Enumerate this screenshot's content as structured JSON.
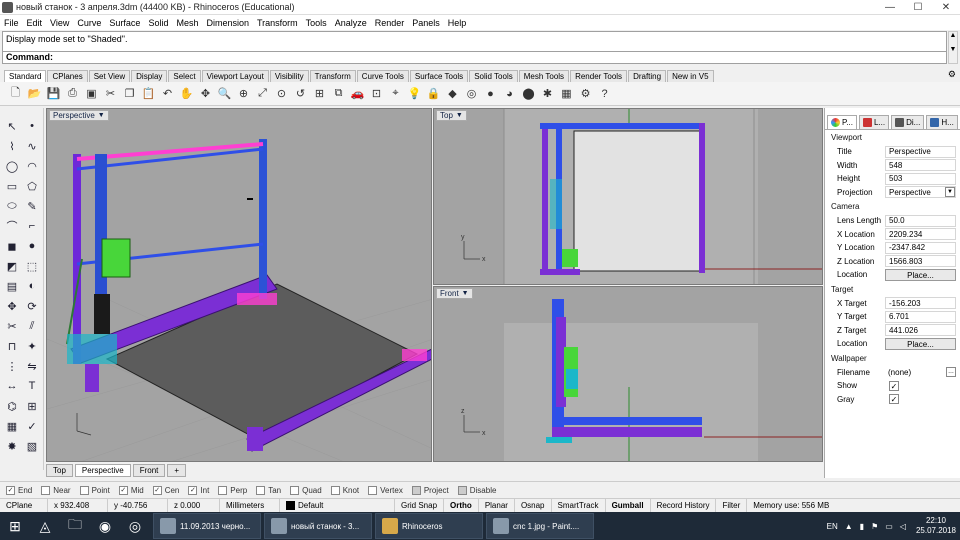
{
  "window": {
    "title": "новый станок - 3 апреля.3dm (44400 KB) - Rhinoceros (Educational)",
    "minimize": "—",
    "maximize": "☐",
    "close": "✕"
  },
  "menu": [
    "File",
    "Edit",
    "View",
    "Curve",
    "Surface",
    "Solid",
    "Mesh",
    "Dimension",
    "Transform",
    "Tools",
    "Analyze",
    "Render",
    "Panels",
    "Help"
  ],
  "command": {
    "history": "Display mode set to \"Shaded\".",
    "prompt": "Command:"
  },
  "toolbar_tabs": [
    "Standard",
    "CPlanes",
    "Set View",
    "Display",
    "Select",
    "Viewport Layout",
    "Visibility",
    "Transform",
    "Curve Tools",
    "Surface Tools",
    "Solid Tools",
    "Mesh Tools",
    "Render Tools",
    "Drafting",
    "New in V5"
  ],
  "viewports": {
    "perspective": "Perspective",
    "top": "Top",
    "front": "Front"
  },
  "viewport_tabs": [
    "Top",
    "Perspective",
    "Front",
    "+"
  ],
  "osnap": [
    {
      "label": "End",
      "checked": true
    },
    {
      "label": "Near",
      "checked": false
    },
    {
      "label": "Point",
      "checked": false
    },
    {
      "label": "Mid",
      "checked": true
    },
    {
      "label": "Cen",
      "checked": true
    },
    {
      "label": "Int",
      "checked": true
    },
    {
      "label": "Perp",
      "checked": false
    },
    {
      "label": "Tan",
      "checked": false
    },
    {
      "label": "Quad",
      "checked": false
    },
    {
      "label": "Knot",
      "checked": false
    },
    {
      "label": "Vertex",
      "checked": false
    },
    {
      "label": "Project",
      "checked": false
    },
    {
      "label": "Disable",
      "checked": false
    }
  ],
  "status": {
    "cplane": "CPlane",
    "x": "x 932.408",
    "y": "y -40.756",
    "z": "z 0.000",
    "units": "Millimeters",
    "layer": "Default",
    "grid_snap": "Grid Snap",
    "ortho": "Ortho",
    "planar": "Planar",
    "osnap": "Osnap",
    "smarttrack": "SmartTrack",
    "gumball": "Gumball",
    "record_history": "Record History",
    "filter": "Filter",
    "memory": "Memory use: 556 MB"
  },
  "panel": {
    "tabs": [
      "P...",
      "L...",
      "Di...",
      "H..."
    ],
    "viewport_header": "Viewport",
    "viewport_rows": [
      {
        "k": "Title",
        "v": "Perspective"
      },
      {
        "k": "Width",
        "v": "548"
      },
      {
        "k": "Height",
        "v": "503"
      },
      {
        "k": "Projection",
        "v": "Perspective"
      }
    ],
    "camera_header": "Camera",
    "camera_rows": [
      {
        "k": "Lens Length",
        "v": "50.0"
      },
      {
        "k": "X Location",
        "v": "2209.234"
      },
      {
        "k": "Y Location",
        "v": "-2347.842"
      },
      {
        "k": "Z Location",
        "v": "1566.803"
      }
    ],
    "camera_location_label": "Location",
    "place_button": "Place...",
    "target_header": "Target",
    "target_rows": [
      {
        "k": "X Target",
        "v": "-156.203"
      },
      {
        "k": "Y Target",
        "v": "6.701"
      },
      {
        "k": "Z Target",
        "v": "441.026"
      }
    ],
    "target_location_label": "Location",
    "wallpaper_header": "Wallpaper",
    "filename_label": "Filename",
    "filename_value": "(none)",
    "show_label": "Show",
    "gray_label": "Gray"
  },
  "taskbar": {
    "apps": [
      "11.09.2013 черно...",
      "новый станок - 3...",
      "Rhinoceros",
      "cnc 1.jpg - Paint...."
    ],
    "lang": "EN",
    "time": "22:10",
    "date": "25.07.2018"
  }
}
